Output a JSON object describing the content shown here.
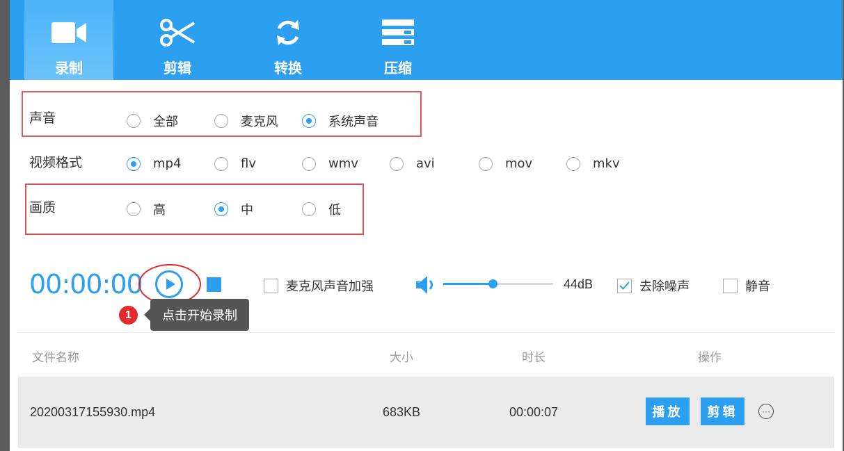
{
  "tabs": [
    {
      "label": "录制",
      "icon": "video-camera-icon",
      "active": true
    },
    {
      "label": "剪辑",
      "icon": "scissors-icon",
      "active": false
    },
    {
      "label": "转换",
      "icon": "refresh-icon",
      "active": false
    },
    {
      "label": "压缩",
      "icon": "compress-icon",
      "active": false
    }
  ],
  "sound": {
    "label": "声音",
    "options": [
      "全部",
      "麦克风",
      "系统声音"
    ],
    "selected": "系统声音"
  },
  "format": {
    "label": "视频格式",
    "options": [
      "mp4",
      "flv",
      "wmv",
      "avi",
      "mov",
      "mkv"
    ],
    "selected": "mp4"
  },
  "quality": {
    "label": "画质",
    "options": [
      "高",
      "中",
      "低"
    ],
    "selected": "中"
  },
  "controls": {
    "timer": "00:00:00",
    "mic_boost_label": "麦克风声音加强",
    "mic_boost_checked": false,
    "volume_db": "44dB",
    "volume_level": 0.45,
    "denoise_label": "去除噪声",
    "denoise_checked": true,
    "mute_label": "静音",
    "mute_checked": false
  },
  "tooltip": {
    "step": "1",
    "text": "点击开始录制"
  },
  "table": {
    "headers": [
      "文件名称",
      "大小",
      "时长",
      "操作"
    ],
    "rows": [
      {
        "name": "20200317155930.mp4",
        "size": "683KB",
        "duration": "00:00:07",
        "play_label": "播放",
        "edit_label": "剪辑"
      }
    ]
  },
  "colors": {
    "accent": "#2c9ff0",
    "highlight_box": "#e05a5a"
  }
}
